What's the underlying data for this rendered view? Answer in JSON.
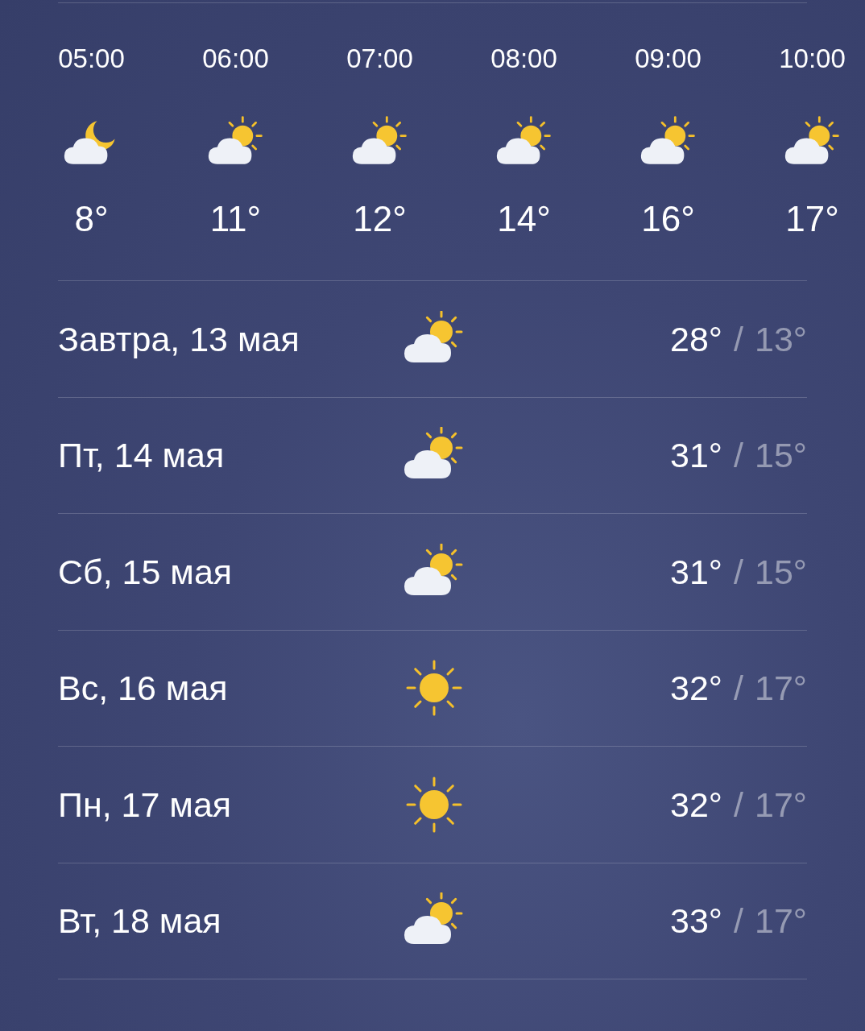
{
  "hourly": [
    {
      "time": "05:00",
      "kind": "moon-cloud",
      "temp": "8°"
    },
    {
      "time": "06:00",
      "kind": "sun-cloud",
      "temp": "11°"
    },
    {
      "time": "07:00",
      "kind": "sun-cloud",
      "temp": "12°"
    },
    {
      "time": "08:00",
      "kind": "sun-cloud",
      "temp": "14°"
    },
    {
      "time": "09:00",
      "kind": "sun-cloud",
      "temp": "16°"
    },
    {
      "time": "10:00",
      "kind": "sun-cloud",
      "temp": "17°"
    }
  ],
  "daily": [
    {
      "day": "Завтра, 13 мая",
      "kind": "sun-cloud",
      "high": "28°",
      "separator": "/",
      "low": "13°"
    },
    {
      "day": "Пт, 14 мая",
      "kind": "sun-cloud",
      "high": "31°",
      "separator": "/",
      "low": "15°"
    },
    {
      "day": "Сб, 15 мая",
      "kind": "sun-cloud",
      "high": "31°",
      "separator": "/",
      "low": "15°"
    },
    {
      "day": "Вс, 16 мая",
      "kind": "sun",
      "high": "32°",
      "separator": "/",
      "low": "17°"
    },
    {
      "day": "Пн, 17 мая",
      "kind": "sun",
      "high": "32°",
      "separator": "/",
      "low": "17°"
    },
    {
      "day": "Вт, 18 мая",
      "kind": "sun-cloud",
      "high": "33°",
      "separator": "/",
      "low": "17°"
    }
  ]
}
